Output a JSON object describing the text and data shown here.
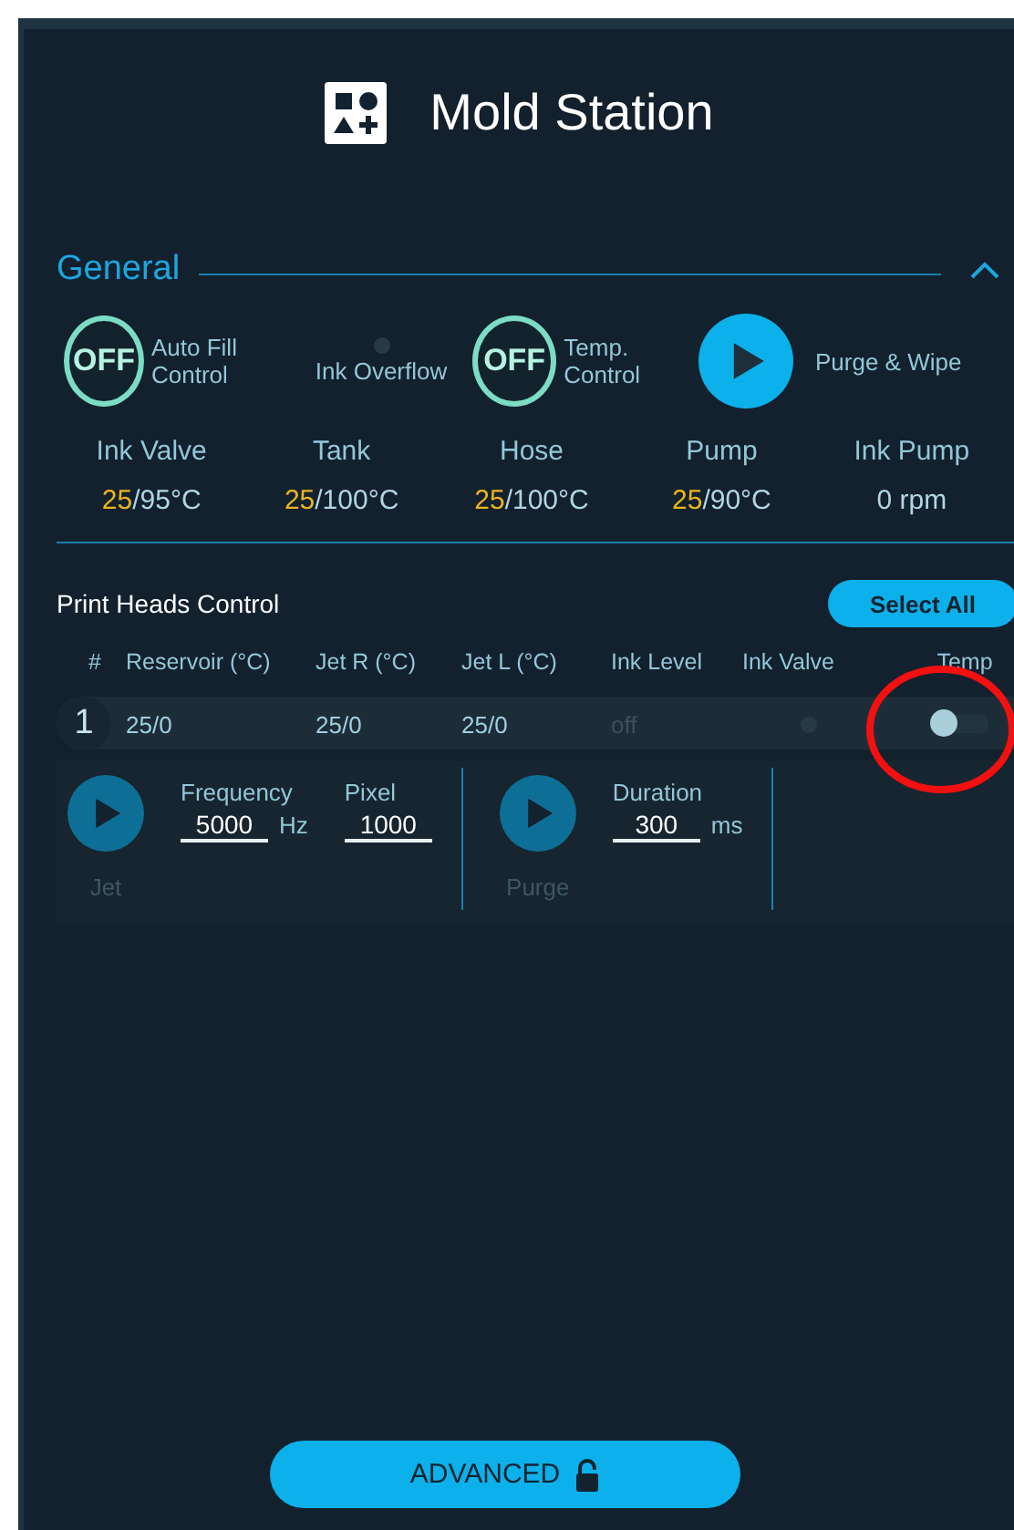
{
  "window": {
    "title": "Mold Station"
  },
  "general": {
    "title": "General",
    "expanded": true,
    "controls": [
      {
        "kind": "toggle",
        "state": "OFF",
        "label": "Auto Fill Control"
      },
      {
        "kind": "indicator",
        "on": false,
        "label": "Ink Overflow"
      },
      {
        "kind": "toggle",
        "state": "OFF",
        "label": "Temp. Control"
      },
      {
        "kind": "action",
        "label": "Purge & Wipe"
      }
    ],
    "readings": [
      {
        "label": "Ink Valve",
        "current": "25",
        "rest": "/95°C"
      },
      {
        "label": "Tank",
        "current": "25",
        "rest": "/100°C"
      },
      {
        "label": "Hose",
        "current": "25",
        "rest": "/100°C"
      },
      {
        "label": "Pump",
        "current": "25",
        "rest": "/90°C"
      },
      {
        "label": "Ink Pump",
        "rest": "0 rpm"
      }
    ]
  },
  "print_heads": {
    "title": "Print Heads Control",
    "select_all": "Select All",
    "columns": [
      "#",
      "Reservoir (°C)",
      "Jet R (°C)",
      "Jet L (°C)",
      "Ink Level",
      "Ink Valve",
      "Temp"
    ],
    "rows": [
      {
        "number": "1",
        "reservoir": "25/0",
        "jet_r": "25/0",
        "jet_l": "25/0",
        "ink_level": "off",
        "ink_valve_on": false,
        "temp_on": false
      }
    ],
    "actions": [
      {
        "label": "Jet",
        "fields": [
          {
            "label": "Frequency",
            "value": "5000",
            "unit": "Hz"
          },
          {
            "label": "Pixel",
            "value": "1000"
          }
        ]
      },
      {
        "label": "Purge",
        "fields": [
          {
            "label": "Duration",
            "value": "300",
            "unit": "ms"
          }
        ]
      }
    ]
  },
  "advanced_button": "ADVANCED",
  "annotations": [
    {
      "kind": "ellipse"
    }
  ]
}
